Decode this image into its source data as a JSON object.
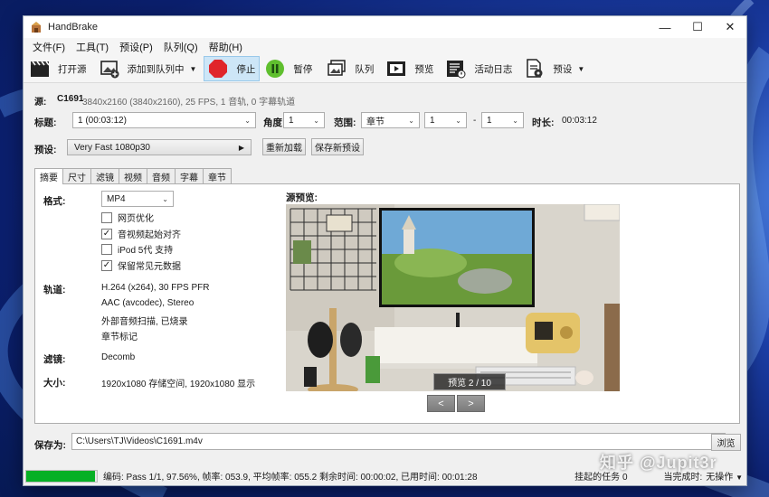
{
  "window": {
    "title": "HandBrake"
  },
  "menu": [
    "文件(F)",
    "工具(T)",
    "预设(P)",
    "队列(Q)",
    "帮助(H)"
  ],
  "toolbar": {
    "open": "打开源",
    "add_queue": "添加到队列中",
    "stop": "停止",
    "pause": "暂停",
    "queue": "队列",
    "preview": "预览",
    "activity": "活动日志",
    "presets": "预设"
  },
  "source": {
    "label": "源:",
    "name": "C1691",
    "info": "3840x2160 (3840x2160), 25 FPS, 1 音轨, 0 字幕轨道"
  },
  "title_row": {
    "title_label": "标题:",
    "title_value": "1  (00:03:12)",
    "angle_label": "角度",
    "angle_value": "1",
    "range_label": "范围:",
    "range_type": "章节",
    "range_start": "1",
    "range_dash": "-",
    "range_end": "1",
    "duration_label": "时长:",
    "duration_value": "00:03:12"
  },
  "preset_row": {
    "label": "预设:",
    "value": "Very Fast 1080p30",
    "reload": "重新加载",
    "save_new": "保存新预设"
  },
  "tabs": [
    "摘要",
    "尺寸",
    "滤镜",
    "视频",
    "音频",
    "字幕",
    "章节"
  ],
  "summary": {
    "format_label": "格式:",
    "format_value": "MP4",
    "options": [
      {
        "label": "网页优化",
        "checked": false
      },
      {
        "label": "音视频起始对齐",
        "checked": true
      },
      {
        "label": "iPod 5代 支持",
        "checked": false
      },
      {
        "label": "保留常见元数据",
        "checked": true
      }
    ],
    "tracks_label": "轨道:",
    "tracks": [
      "H.264 (x264), 30 FPS PFR",
      "AAC (avcodec), Stereo",
      "外部音频扫描, 已烧录",
      "章节标记"
    ],
    "filters_label": "滤镜:",
    "filters_value": "Decomb",
    "size_label": "大小:",
    "size_value": "1920x1080 存储空间, 1920x1080 显示",
    "preview_label": "源预览:",
    "preview_counter": "预览 2 / 10",
    "prev_btn": "<",
    "next_btn": ">"
  },
  "save": {
    "label": "保存为:",
    "path": "C:\\Users\\TJ\\Videos\\C1691.m4v",
    "browse": "浏览"
  },
  "status": {
    "progress": 97.56,
    "text": "编码: Pass 1/1, 97.56%, 帧率: 053.9, 平均帧率: 055.2 剩余时间: 00:00:02, 已用时间: 00:01:28",
    "queue_pending": "挂起的任务 0",
    "when_done_label": "当完成时:",
    "when_done_value": "无操作"
  },
  "watermark": "知乎 @Jupit3r",
  "colors": {
    "accent_green": "#06b025",
    "stop_red": "#e0252a",
    "pause_green": "#5fbf2e"
  }
}
